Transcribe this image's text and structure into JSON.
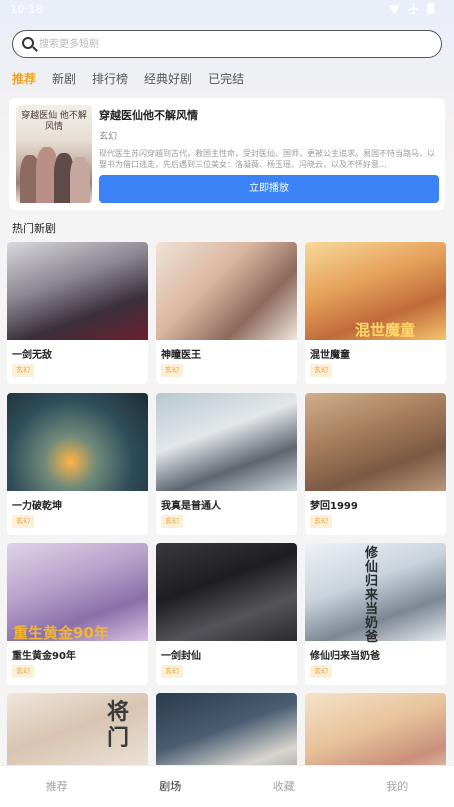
{
  "status_bar": {
    "time": "10:18",
    "icons": [
      "wifi-icon",
      "airplane-icon",
      "battery-icon"
    ]
  },
  "search": {
    "placeholder": "搜索更多短剧",
    "value": ""
  },
  "tabs": [
    {
      "label": "推荐",
      "active": true
    },
    {
      "label": "新剧",
      "active": false
    },
    {
      "label": "排行榜",
      "active": false
    },
    {
      "label": "经典好剧",
      "active": false
    },
    {
      "label": "已完结",
      "active": false
    }
  ],
  "featured": {
    "poster_title": "穿越医仙 他不解风情",
    "title": "穿越医仙他不解风情",
    "genre": "玄幻",
    "description": "现代医生苏闪穿越到古代，救国主性命，受封医仙、国师，更被公主追求。易国不恃当路马，以娶书为借口逃走，先后遇到三位美女：洛凝薇、杨玉瑶、冯晓云，以及不怀好意...",
    "play_label": "立即播放"
  },
  "section_title": "热门新剧",
  "cards": [
    {
      "name": "一剑无敌",
      "tag": "玄幻"
    },
    {
      "name": "神瞳医王",
      "tag": "玄幻"
    },
    {
      "name": "混世魔童",
      "tag": "玄幻",
      "overlay": "混世魔童"
    },
    {
      "name": "一力破乾坤",
      "tag": "玄幻"
    },
    {
      "name": "我真是普通人",
      "tag": "玄幻"
    },
    {
      "name": "梦回1999",
      "tag": "玄幻"
    },
    {
      "name": "重生黄金90年",
      "tag": "玄幻",
      "overlay": "重生黄金90年"
    },
    {
      "name": "一剑封仙",
      "tag": "玄幻"
    },
    {
      "name": "修仙归来当奶爸",
      "tag": "玄幻",
      "overlay": "修仙归来当奶爸"
    },
    {
      "name": "",
      "tag": "",
      "overlay": "将门"
    },
    {
      "name": "",
      "tag": ""
    },
    {
      "name": "",
      "tag": ""
    }
  ],
  "bottom_nav": [
    {
      "label": "推荐",
      "active": false
    },
    {
      "label": "剧场",
      "active": true
    },
    {
      "label": "收藏",
      "active": false
    },
    {
      "label": "我的",
      "active": false
    }
  ],
  "colors": {
    "accent": "#f0a323",
    "primary_button": "#3a82f5",
    "tag_bg": "#fdf0d8",
    "tag_text": "#e8a13d"
  }
}
